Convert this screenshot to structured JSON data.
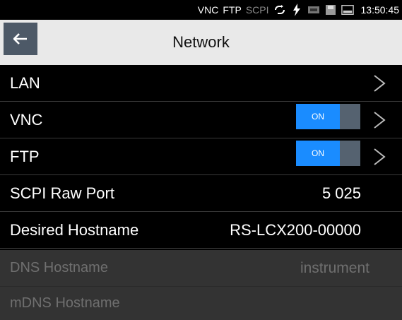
{
  "status_bar": {
    "vnc": "VNC",
    "ftp": "FTP",
    "scpi": "SCPI",
    "icons": [
      "remote-loop-icon",
      "lightning-icon",
      "gpib-icon",
      "save-icon",
      "display-icon"
    ],
    "time": "13:50:45"
  },
  "header": {
    "title": "Network",
    "back_icon": "arrow-left-icon"
  },
  "rows": {
    "lan": {
      "label": "LAN"
    },
    "vnc": {
      "label": "VNC",
      "toggle": "ON"
    },
    "ftp": {
      "label": "FTP",
      "toggle": "ON"
    },
    "scpi_port": {
      "label": "SCPI Raw Port",
      "value": "5 025"
    },
    "desired_hostname": {
      "label": "Desired Hostname",
      "value": "RS-LCX200-00000"
    },
    "dns_hostname": {
      "label": "DNS Hostname",
      "value": "instrument"
    },
    "mdns_hostname": {
      "label": "mDNS Hostname"
    }
  },
  "colors": {
    "header_bg": "#e9e9e9",
    "back_button_bg": "#4d5967",
    "toggle_on": "#1a8cff",
    "toggle_knob": "#556270",
    "disabled_row_bg": "#333333"
  }
}
